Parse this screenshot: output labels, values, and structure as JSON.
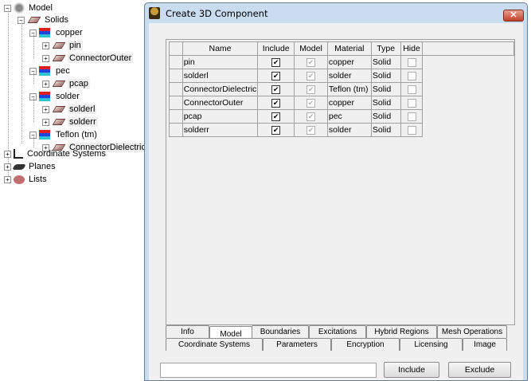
{
  "tree": {
    "model": "Model",
    "solids": "Solids",
    "materials": [
      {
        "name": "copper",
        "objects": [
          "pin",
          "ConnectorOuter"
        ]
      },
      {
        "name": "pec",
        "objects": [
          "pcap"
        ]
      },
      {
        "name": "solder",
        "objects": [
          "solderl",
          "solderr"
        ]
      },
      {
        "name": "Teflon (tm)",
        "objects": [
          "ConnectorDielectric"
        ]
      }
    ],
    "others": [
      "Coordinate Systems",
      "Planes",
      "Lists"
    ]
  },
  "dialog": {
    "title": "Create 3D Component",
    "close": "✕",
    "columns": [
      "Name",
      "Include",
      "Model",
      "Material",
      "Type",
      "Hide"
    ],
    "rows": [
      {
        "name": "pin",
        "include": true,
        "model": true,
        "material": "copper",
        "type": "Solid",
        "hide": false
      },
      {
        "name": "solderl",
        "include": true,
        "model": true,
        "material": "solder",
        "type": "Solid",
        "hide": false
      },
      {
        "name": "ConnectorDielectric",
        "include": true,
        "model": true,
        "material": "Teflon (tm)",
        "type": "Solid",
        "hide": false
      },
      {
        "name": "ConnectorOuter",
        "include": true,
        "model": true,
        "material": "copper",
        "type": "Solid",
        "hide": false
      },
      {
        "name": "pcap",
        "include": true,
        "model": true,
        "material": "pec",
        "type": "Solid",
        "hide": false
      },
      {
        "name": "solderr",
        "include": true,
        "model": true,
        "material": "solder",
        "type": "Solid",
        "hide": false
      }
    ],
    "tabs_row1": [
      "Info",
      "Model",
      "Boundaries",
      "Excitations",
      "Hybrid Regions",
      "Mesh Operations"
    ],
    "tabs_row2": [
      "Coordinate Systems",
      "Parameters",
      "Encryption",
      "Licensing",
      "Image"
    ],
    "active_tab": "Model",
    "input_value": "",
    "include_button": "Include",
    "exclude_button": "Exclude"
  }
}
